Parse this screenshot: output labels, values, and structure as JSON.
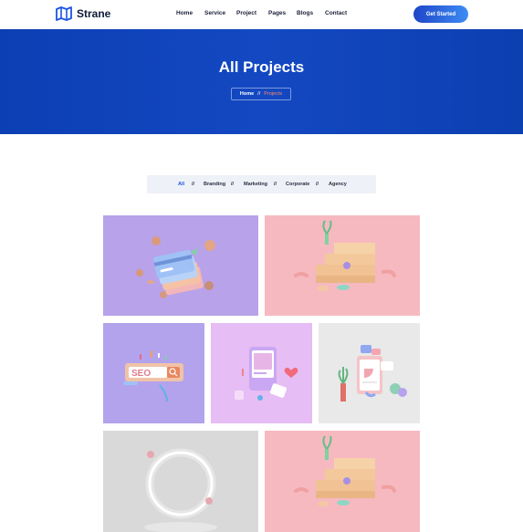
{
  "brand": {
    "name": "Strane",
    "logo_icon": "map-icon"
  },
  "nav": {
    "items": [
      {
        "label": "Home"
      },
      {
        "label": "Service"
      },
      {
        "label": "Project"
      },
      {
        "label": "Pages"
      },
      {
        "label": "Blogs"
      },
      {
        "label": "Contact"
      }
    ],
    "cta_label": "Get Started"
  },
  "hero": {
    "title": "All Projects",
    "breadcrumb": {
      "home": "Home",
      "separator": "//",
      "current": "Projects"
    }
  },
  "filter": {
    "items": [
      {
        "label": "All",
        "active": true
      },
      {
        "label": "Branding",
        "active": false
      },
      {
        "label": "Marketing",
        "active": false
      },
      {
        "label": "Corporate",
        "active": false
      },
      {
        "label": "Agency",
        "active": false
      }
    ],
    "separator": "//"
  },
  "projects": [
    {
      "illustration": "floating-credit-cards-and-coins",
      "background": "#b8a2ea"
    },
    {
      "illustration": "staircase-with-plant",
      "background": "#f6b9c0"
    },
    {
      "illustration": "seo-search-bar",
      "background": "#b3a3ec"
    },
    {
      "illustration": "phone-with-heart",
      "background": "#e6bdf4"
    },
    {
      "illustration": "analytics-board-with-plants",
      "background": "#e9e9e9"
    },
    {
      "illustration": "glowing-ring",
      "background": "#d9d9d9"
    },
    {
      "illustration": "staircase-with-plant",
      "background": "#f6b9c0"
    }
  ],
  "colors": {
    "primary": "#0c3fb4",
    "accent": "#ff8a6a",
    "active_filter": "#1d53e6",
    "text_dark": "#1a1f36"
  }
}
